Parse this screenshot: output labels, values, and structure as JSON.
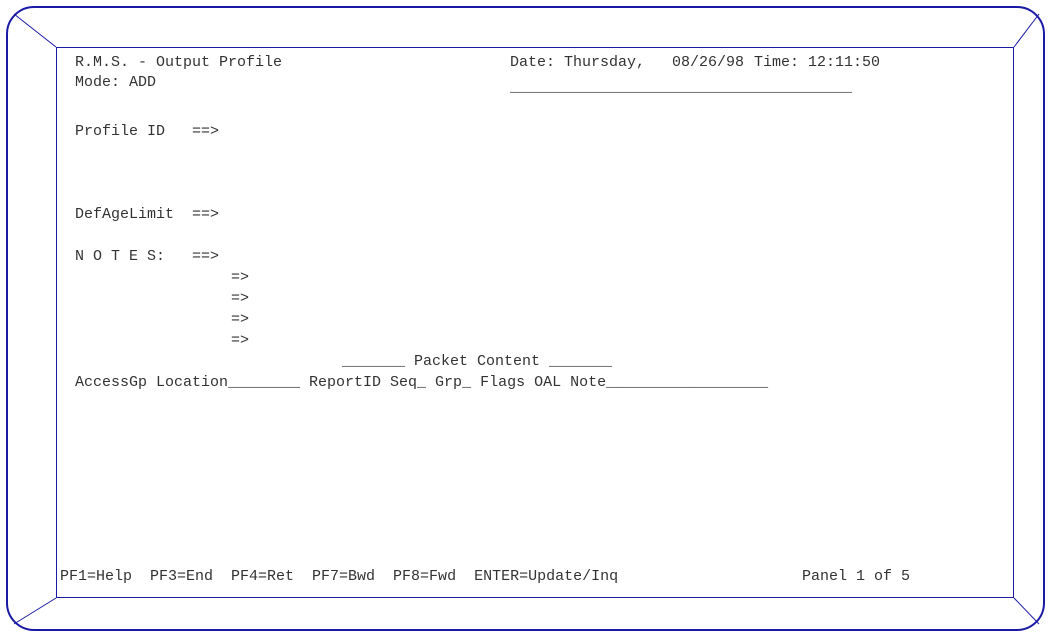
{
  "header": {
    "title": "R.M.S. - Output Profile",
    "date_label": "Date: Thursday,",
    "date_value": "08/26/98",
    "time_label": "Time:",
    "time_value": "12:11:50",
    "mode": "Mode: ADD",
    "underline": "______________________________________"
  },
  "fields": {
    "profile_id": "Profile ID   ==>",
    "def_age_limit": "DefAgeLimit  ==>",
    "notes_label": "N O T E S:   ==>",
    "notes_continuation": [
      "=>",
      "=>",
      "=>",
      "=>"
    ]
  },
  "table": {
    "packet_header": "_______ Packet Content _______",
    "columns": "AccessGp Location________ ReportID Seq_ Grp_ Flags OAL Note__________________"
  },
  "footer": {
    "keys": "PF1=Help  PF3=End  PF4=Ret  PF7=Bwd  PF8=Fwd  ENTER=Update/Inq",
    "panel": "Panel 1 of 5"
  },
  "colors": {
    "frame": "#1a1aa6",
    "text": "#333333"
  }
}
